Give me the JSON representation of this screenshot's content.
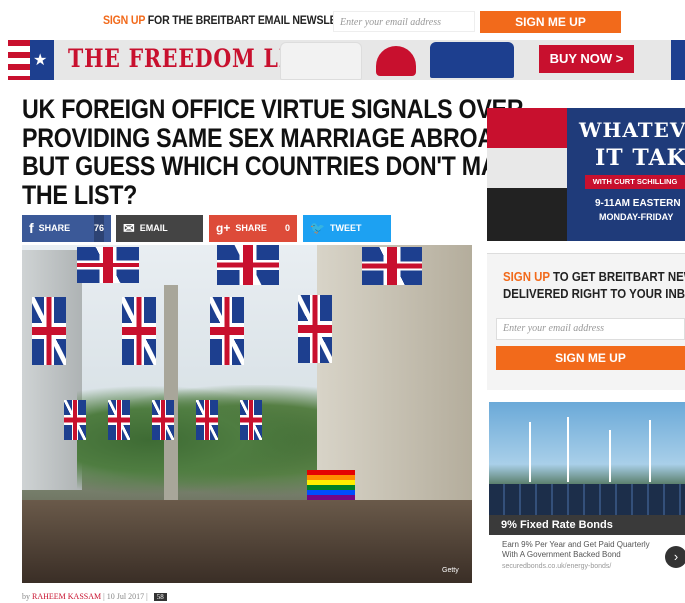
{
  "newsletter_bar": {
    "signup_highlight": "SIGN UP",
    "signup_text": " FOR THE BREITBART EMAIL NEWSLETTER",
    "email_placeholder": "Enter your email address",
    "button_label": "SIGN ME UP"
  },
  "banner_ad": {
    "title": "THE FREEDOM LINE",
    "cta": "BUY NOW >"
  },
  "article": {
    "headline_lines": [
      "UK FOREIGN OFFICE VIRTUE SIGNALS OVER",
      "PROVIDING SAME SEX MARRIAGE ABROAD,",
      "BUT GUESS WHICH COUNTRIES DON'T MAKE",
      "THE LIST?"
    ],
    "share_buttons": [
      {
        "label": "SHARE",
        "count": "76",
        "icon": "facebook-icon",
        "glyph": "f"
      },
      {
        "label": "EMAIL",
        "count": "",
        "icon": "email-icon",
        "glyph": "✉"
      },
      {
        "label": "SHARE",
        "count": "0",
        "icon": "google-plus-icon",
        "glyph": "g+"
      },
      {
        "label": "TWEET",
        "count": "",
        "icon": "twitter-icon",
        "glyph": "🐦"
      }
    ],
    "photo_credit": "Getty",
    "byline_prefix": "by",
    "author": "RAHEEM KASSAM",
    "date": "10 Jul 2017",
    "comment_count": "58"
  },
  "sidebar": {
    "ad1": {
      "line1": "WHATEVER",
      "line2": "IT TAKES",
      "line3": "WITH CURT SCHILLING",
      "line4": "9-11AM EASTERN",
      "line5": "MONDAY-FRIDAY"
    },
    "newsletter": {
      "title_highlight": "SIGN UP",
      "title_rest": " TO GET BREITBART NEWS",
      "title_line2": "DELIVERED RIGHT TO YOUR INBOX",
      "email_placeholder": "Enter your email address",
      "button_label": "SIGN ME UP"
    },
    "ad2": {
      "label": "9% Fixed Rate Bonds",
      "text": "Earn 9% Per Year and Get Paid Quarterly With A Government Backed Bond",
      "url": "securedbonds.co.uk/energy-bonds/",
      "arrow": "›"
    }
  },
  "colors": {
    "accent_orange": "#f26a1b",
    "brand_red": "#c8102e",
    "facebook_blue": "#3b5998",
    "twitter_blue": "#1da1f2"
  }
}
